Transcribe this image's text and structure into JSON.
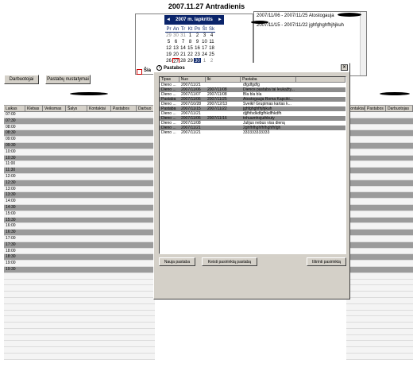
{
  "header": {
    "title": "2007.11.27 Antradienis"
  },
  "calendar": {
    "prev": "◄",
    "next": "►",
    "month_label": "2007 m. lapkritis",
    "weekdays": [
      "Pr",
      "An",
      "Tr",
      "Kt",
      "Pn",
      "Št",
      "Sk"
    ],
    "weeks": [
      [
        "29",
        "30",
        "31",
        "1",
        "2",
        "3",
        "4"
      ],
      [
        "5",
        "6",
        "7",
        "8",
        "9",
        "10",
        "11"
      ],
      [
        "12",
        "13",
        "14",
        "15",
        "16",
        "17",
        "18"
      ],
      [
        "19",
        "20",
        "21",
        "22",
        "23",
        "24",
        "25"
      ],
      [
        "26",
        "27",
        "28",
        "29",
        "30",
        "1",
        "2"
      ]
    ],
    "today_checkbox_label": "Šia"
  },
  "events": {
    "items": [
      "2007/11/06 - 2007/11/25 Atostogauja",
      "2007/11/15 - 2007/11/22 jghfghghfhjhjkuh"
    ]
  },
  "buttons": {
    "darbuotojai": "Darbuotojai",
    "pastabu_nustatymai": "Pastabų nustatymai"
  },
  "schedule": {
    "columns_left": [
      "Laikas",
      "Klebas",
      "Veiksmas",
      "Šalys",
      "Kontaktai",
      "Pastabos",
      "Darbuo"
    ],
    "columns_right": [
      "Kontaktai",
      "Pastabos",
      "Darbuotojas"
    ],
    "times": [
      "07:00",
      "07:30",
      "08:00",
      "08:30",
      "09:00",
      "09:30",
      "10:00",
      "10:30",
      "11:00",
      "11:30",
      "12:00",
      "12:30",
      "13:00",
      "13:30",
      "14:00",
      "14:30",
      "15:00",
      "15:30",
      "16:00",
      "16:30",
      "17:00",
      "17:30",
      "18:00",
      "18:30",
      "19:00",
      "19:30"
    ]
  },
  "dialog": {
    "title": "Pastabos",
    "close": "×",
    "columns": [
      "Tipas",
      "Nuo",
      "Iki",
      "Pastaba"
    ],
    "rows": [
      [
        "Dieno ...",
        "2007/11/21",
        "",
        "dfgdfgdfg"
      ],
      [
        "Dieno ...",
        "2007/11/06",
        "2007/11/08",
        "Dienos pastaba tai leukažty..."
      ],
      [
        "Dieno ...",
        "2007/11/07",
        "2007/11/08",
        "Bla bla bla"
      ],
      [
        "Pastaba",
        "2007/11/06",
        "2007/11/25",
        "Atostogauja Roma Kapciki..."
      ],
      [
        "Dieno ...",
        "2007/10/28",
        "2007/12/13",
        "Sveiki! Grupimas kartas k..."
      ],
      [
        "Pastaba",
        "2007/11/15",
        "2007/11/22",
        "jghfghghfhjhjkuh"
      ],
      [
        "Dieno ...",
        "2007/11/21",
        "",
        "djjfhfsdkdfgfhkdfhkdfh"
      ],
      [
        "Dieno ...",
        "2007/11/06",
        "2007/11/16",
        "tnhuumhojuthbuty"
      ],
      [
        "Dieno ...",
        "2007/11/08",
        "",
        "Julijus nebus visa dieną"
      ],
      [
        "Dieno ...",
        "2007/11/21",
        "",
        "2ghfhfhghfhfhghfhfgh"
      ],
      [
        "Dieno ...",
        "2007/11/21",
        "",
        "333333333333"
      ]
    ],
    "buttons": {
      "new": "Nauja pastaba",
      "edit": "Keisti pasirinktą pastabą",
      "delete": "Ištrinti pasirinktą"
    }
  }
}
